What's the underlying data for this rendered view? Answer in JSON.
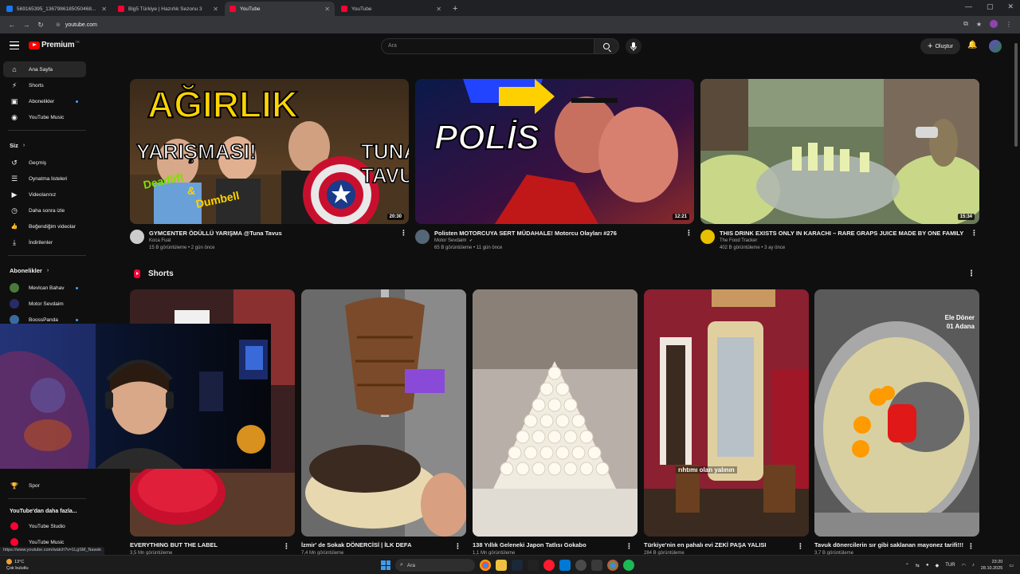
{
  "browser": {
    "tabs": [
      {
        "title": "569165395_1367986185050468...",
        "fav": "#1877f2",
        "active": false
      },
      {
        "title": "Big5 Türkiye | Hazırlık Sezonu 3",
        "fav": "#ff0033",
        "active": false
      },
      {
        "title": "YouTube",
        "fav": "#ff0033",
        "active": true
      },
      {
        "title": "YouTube",
        "fav": "#ff0033",
        "active": false
      }
    ],
    "url": "youtube.com",
    "status_url": "https://www.youtube.com/watch?v=1LgSM_Nawsk"
  },
  "header": {
    "logo_text": "Premium",
    "logo_superscript": "TR",
    "search_placeholder": "Ara",
    "create_label": "Oluştur"
  },
  "sidebar": {
    "main": [
      {
        "label": "Ana Sayfa",
        "icon": "home-icon",
        "glyph": "⌂",
        "active": true
      },
      {
        "label": "Shorts",
        "icon": "shorts-icon",
        "glyph": "⚡"
      },
      {
        "label": "Abonelikler",
        "icon": "subscriptions-icon",
        "glyph": "▣",
        "dot": true
      },
      {
        "label": "YouTube Music",
        "icon": "music-icon",
        "glyph": "◉"
      }
    ],
    "you_heading": "Siz",
    "you": [
      {
        "label": "Geçmiş",
        "icon": "history-icon",
        "glyph": "↺"
      },
      {
        "label": "Oynatma listeleri",
        "icon": "playlists-icon",
        "glyph": "☰"
      },
      {
        "label": "Videolarınız",
        "icon": "your-videos-icon",
        "glyph": "▶"
      },
      {
        "label": "Daha sonra izle",
        "icon": "watch-later-icon",
        "glyph": "◷"
      },
      {
        "label": "Beğendiğim videolar",
        "icon": "like-icon",
        "glyph": "👍"
      },
      {
        "label": "İndirilenler",
        "icon": "download-icon",
        "glyph": "⤓"
      }
    ],
    "subs_heading": "Abonelikler",
    "subs": [
      {
        "label": "Mevlcan Bahav",
        "color": "#4a7a3a",
        "dot": true
      },
      {
        "label": "Motor Sevdaim",
        "color": "#2a2a6a"
      },
      {
        "label": "BoossPanda",
        "color": "#3a6aa0",
        "dot": true
      }
    ],
    "explore": [
      {
        "label": "Spor",
        "icon": "trophy-icon",
        "glyph": "🏆"
      }
    ],
    "more_heading": "YouTube'dan daha fazla...",
    "more": [
      {
        "label": "YouTube Studio"
      },
      {
        "label": "YouTube Music"
      }
    ]
  },
  "videos": [
    {
      "title": "GYMCENTER ÖDÜLLÜ YARIŞMA  @Tuna Tavus",
      "channel": "Koca Fuat",
      "stats": "15 B görüntüleme • 2 gün önce",
      "duration": "20:30",
      "avatar_color": "#cccccc",
      "thumb_texts": [
        "AĞIRLIK",
        "YARIŞMASI!",
        "TUNA",
        "TAVUS",
        "Deadlift",
        "&",
        "Dumbell"
      ]
    },
    {
      "title": "Polisten MOTORCUYA SERT MÜDAHALE! Motorcu Olayları #276",
      "channel": "Motor Sevdaim",
      "verified": "✔",
      "stats": "65 B görüntüleme • 11 gün önce",
      "duration": "12:21",
      "avatar_color": "#556677",
      "thumb_texts": [
        "POLİS"
      ]
    },
    {
      "title": "THIS DRINK EXISTS ONLY IN KARACHI – RARE GRAPS JUICE MADE BY ONE FAMILY",
      "channel": "The Food Tracker",
      "stats": "402 B görüntüleme • 3 ay önce",
      "duration": "15:34",
      "avatar_color": "#e8c000",
      "thumb_texts": []
    }
  ],
  "shorts": {
    "heading": "Shorts",
    "items": [
      {
        "title": "EVERYTHING BUT THE LABEL",
        "views": "3,5 Mn görüntüleme",
        "overlay": ""
      },
      {
        "title": "İzmir' de Sokak DÖNERCİSİ | İLK DEFA",
        "views": "7,4 Mn görüntüleme",
        "overlay": ""
      },
      {
        "title": "138 Yıllık Geleneki Japon Tatlısı Gokabo",
        "views": "1,1 Mn görüntüleme",
        "overlay": ""
      },
      {
        "title": "Türkiye'nin en pahalı evi ZEKİ PAŞA YALISI",
        "views": "284 B görüntüleme",
        "overlay": "rıhtımı olan yalının"
      },
      {
        "title": "Tavuk dönercilerin sır gibi saklanan mayonez tarifi!!!",
        "views": "3,7 B görüntüleme",
        "overlay": "Ele Döner 01 Adana"
      }
    ]
  },
  "taskbar": {
    "temperature": "13°C",
    "weather": "Çok bulutlu",
    "search": "Ara",
    "lang": "TUR",
    "time": "23:20",
    "date": "28.10.2025"
  }
}
